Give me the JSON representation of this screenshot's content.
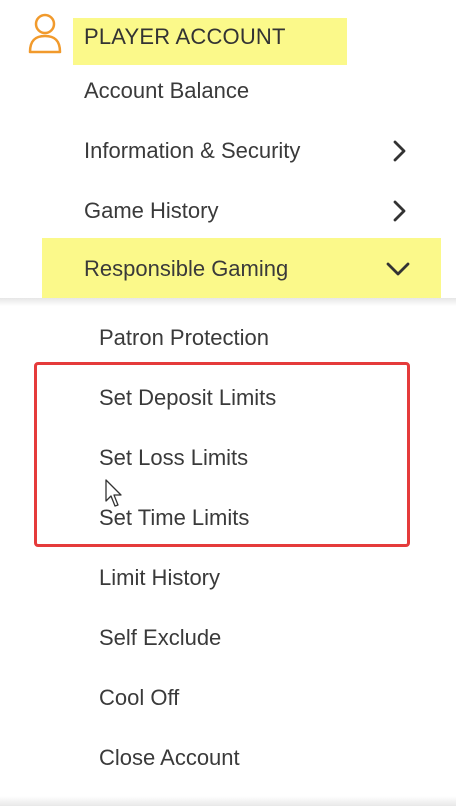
{
  "header": {
    "title": "PLAYER ACCOUNT",
    "icon": "user-icon",
    "accent_color": "#f19a2c",
    "highlight_color": "#fbf98a"
  },
  "menu": [
    {
      "label": "Account Balance",
      "chevron": "none"
    },
    {
      "label": "Information & Security",
      "chevron": "right"
    },
    {
      "label": "Game History",
      "chevron": "right"
    },
    {
      "label": "Responsible Gaming",
      "chevron": "down",
      "expanded": true
    }
  ],
  "submenu": [
    {
      "label": "Patron Protection"
    },
    {
      "label": "Set Deposit Limits"
    },
    {
      "label": "Set Loss Limits"
    },
    {
      "label": "Set Time Limits"
    },
    {
      "label": "Limit History"
    },
    {
      "label": "Self Exclude"
    },
    {
      "label": "Cool Off"
    },
    {
      "label": "Close Account"
    }
  ],
  "annotation": {
    "color": "#e53b3b"
  }
}
